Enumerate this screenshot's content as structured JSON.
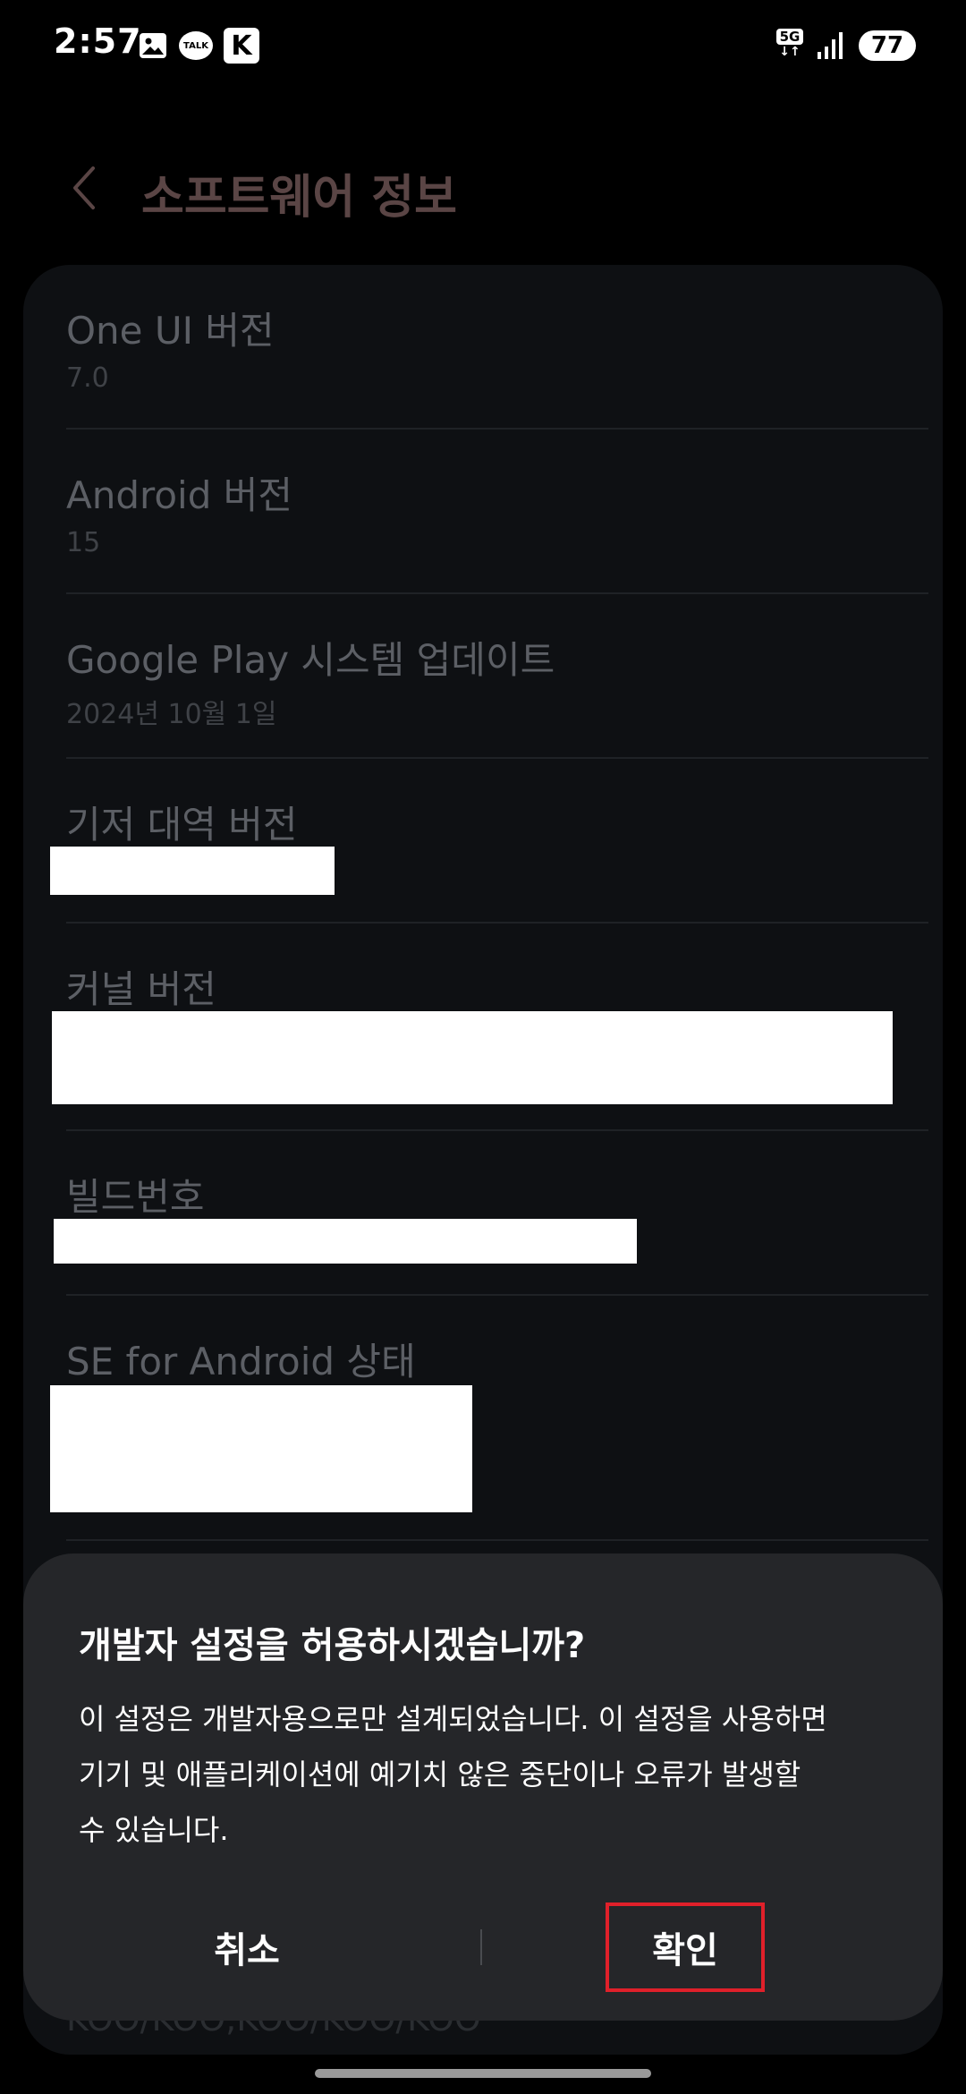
{
  "status_bar": {
    "time": "2:57",
    "talk_label": "TALK",
    "k_label": "K",
    "network_type": "5G",
    "network_arrows": "↓↑",
    "battery_level": "77"
  },
  "header": {
    "title": "소프트웨어 정보"
  },
  "items": [
    {
      "title": "One UI 버전",
      "value": "7.0"
    },
    {
      "title": "Android 버전",
      "value": "15"
    },
    {
      "title": "Google Play 시스템 업데이트",
      "value": "2024년 10월 1일"
    },
    {
      "title": "기저 대역 버전",
      "value": ""
    },
    {
      "title": "커널 버전",
      "value": ""
    },
    {
      "title": "빌드번호",
      "value": ""
    },
    {
      "title": "SE for Android 상태",
      "value": ""
    }
  ],
  "card_footer_text": "KOO/KOO,KOO/KOO/KOO",
  "dialog": {
    "title": "개발자 설정을 허용하시겠습니까?",
    "message_line1": "이 설정은 개발자용으로만 설계되었습니다. 이 설정을 사용하면",
    "message_line2": "기기 및 애플리케이션에 예기치 않은 중단이나 오류가 발생할",
    "message_line3": "수 있습니다.",
    "cancel_label": "취소",
    "confirm_label": "확인"
  },
  "colors": {
    "background": "#000000",
    "card": "#0e1013",
    "dialog": "#252629",
    "highlight_border": "#e0202a",
    "title_dim": "#5a4545"
  }
}
